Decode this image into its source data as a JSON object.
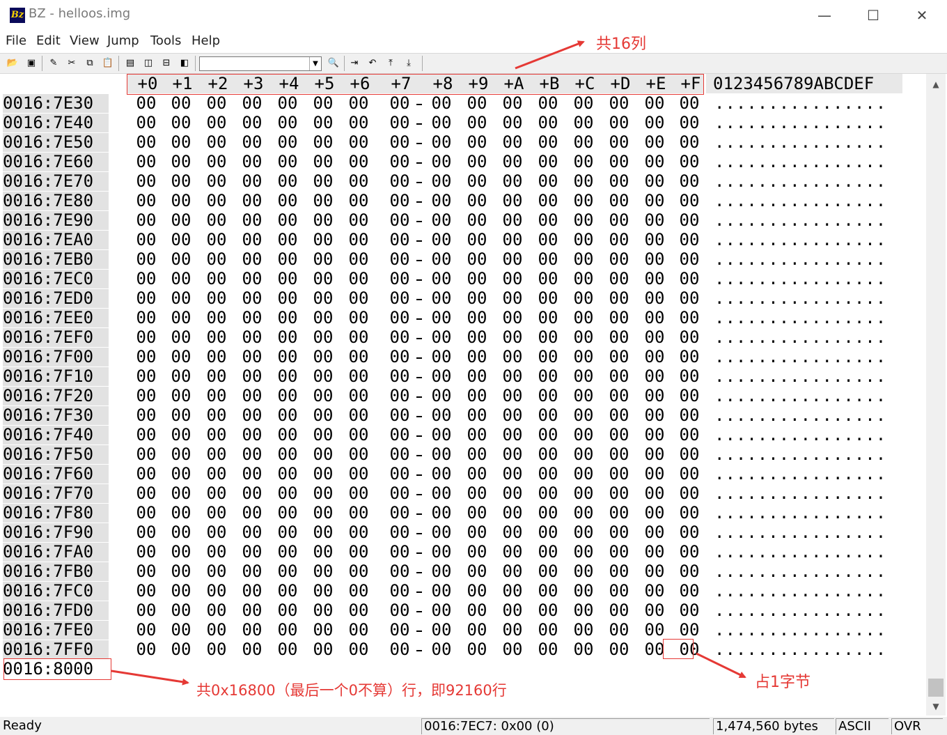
{
  "window": {
    "icon_text": "Bz",
    "title": "BZ - helloos.img",
    "minimize": "—",
    "maximize": "☐",
    "close": "✕"
  },
  "menu": [
    "File",
    "Edit",
    "View",
    "Jump",
    "Tools",
    "Help"
  ],
  "toolbar": {
    "buttons": [
      {
        "name": "open-icon",
        "glyph": "📂"
      },
      {
        "name": "save-icon",
        "glyph": "▣"
      },
      {
        "name": "edit-icon",
        "glyph": "✎"
      },
      {
        "name": "cut-icon",
        "glyph": "✂"
      },
      {
        "name": "copy-icon",
        "glyph": "⧉"
      },
      {
        "name": "paste-icon",
        "glyph": "📋"
      },
      {
        "name": "view-single-icon",
        "glyph": "▤"
      },
      {
        "name": "view-split-h-icon",
        "glyph": "◫"
      },
      {
        "name": "view-split-v-icon",
        "glyph": "⊟"
      },
      {
        "name": "view-cols-icon",
        "glyph": "◧"
      },
      {
        "name": "find-icon",
        "glyph": "🔍"
      },
      {
        "name": "jump-icon",
        "glyph": "⇥"
      },
      {
        "name": "undo-icon",
        "glyph": "↶"
      },
      {
        "name": "goto-top-icon",
        "glyph": "⤒"
      },
      {
        "name": "goto-bottom-icon",
        "glyph": "⤓"
      }
    ],
    "search_value": "",
    "combo_arrow": "▼"
  },
  "column_headers": [
    "+0",
    "+1",
    "+2",
    "+3",
    "+4",
    "+5",
    "+6",
    "+7",
    "+8",
    "+9",
    "+A",
    "+B",
    "+C",
    "+D",
    "+E",
    "+F"
  ],
  "ascii_header": "0123456789ABCDEF",
  "byte_value": "00",
  "ascii_row": "................",
  "addresses": [
    "0016:7E30",
    "0016:7E40",
    "0016:7E50",
    "0016:7E60",
    "0016:7E70",
    "0016:7E80",
    "0016:7E90",
    "0016:7EA0",
    "0016:7EB0",
    "0016:7EC0",
    "0016:7ED0",
    "0016:7EE0",
    "0016:7EF0",
    "0016:7F00",
    "0016:7F10",
    "0016:7F20",
    "0016:7F30",
    "0016:7F40",
    "0016:7F50",
    "0016:7F60",
    "0016:7F70",
    "0016:7F80",
    "0016:7F90",
    "0016:7FA0",
    "0016:7FB0",
    "0016:7FC0",
    "0016:7FD0",
    "0016:7FE0",
    "0016:7FF0"
  ],
  "final_address": "0016:8000",
  "scrollbar": {
    "up": "▲",
    "down": "▼"
  },
  "status": {
    "state": "Ready",
    "cursor": "0016:7EC7: 0x00 (0)",
    "size": "1,474,560 bytes",
    "charset": "ASCII",
    "mode": "OVR"
  },
  "annotations": {
    "columns_note": "共16列",
    "rows_note": "共0x16800（最后一个0不算）行，即92160行",
    "byte_note": "占1字节",
    "color": "#e53935"
  }
}
